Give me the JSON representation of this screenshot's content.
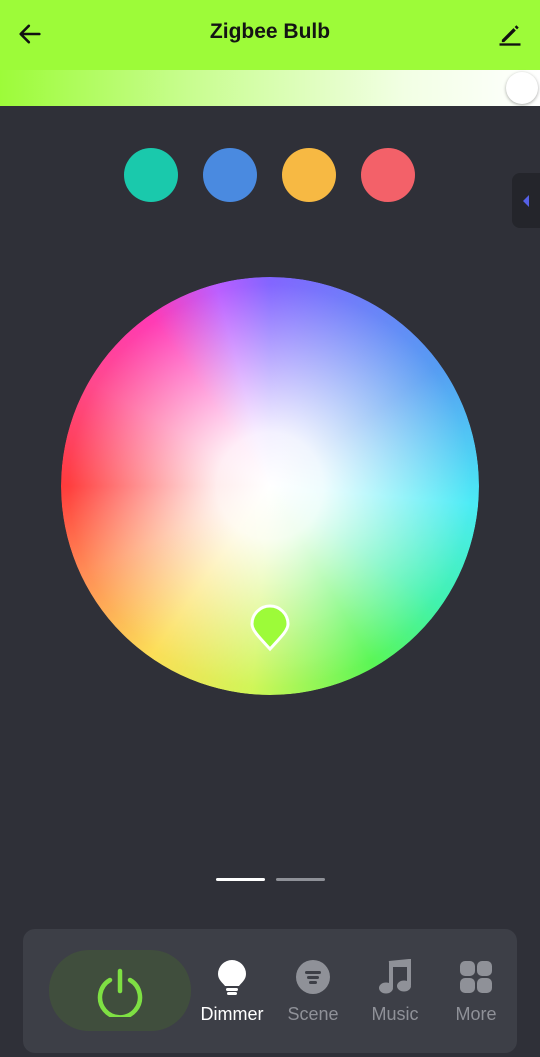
{
  "header": {
    "title": "Zigbee Bulb",
    "back_icon": "arrow-left-icon",
    "edit_icon": "pencil-icon",
    "background_color": "#9dfb39"
  },
  "brightness": {
    "level_percent": 100
  },
  "preset_colors": [
    "#1ac9ac",
    "#4a8ae0",
    "#f7b943",
    "#f36169"
  ],
  "color_wheel": {
    "selected_color": "#9dfb39"
  },
  "pager": {
    "pages": 2,
    "active_page": 1
  },
  "bottom_nav": {
    "power_icon": "power-icon",
    "power_color": "#7ee043",
    "items": [
      {
        "label": "Dimmer",
        "icon": "bulb-icon",
        "active": true
      },
      {
        "label": "Scene",
        "icon": "scene-icon",
        "active": false
      },
      {
        "label": "Music",
        "icon": "music-note-icon",
        "active": false
      },
      {
        "label": "More",
        "icon": "grid-icon",
        "active": false
      }
    ]
  }
}
